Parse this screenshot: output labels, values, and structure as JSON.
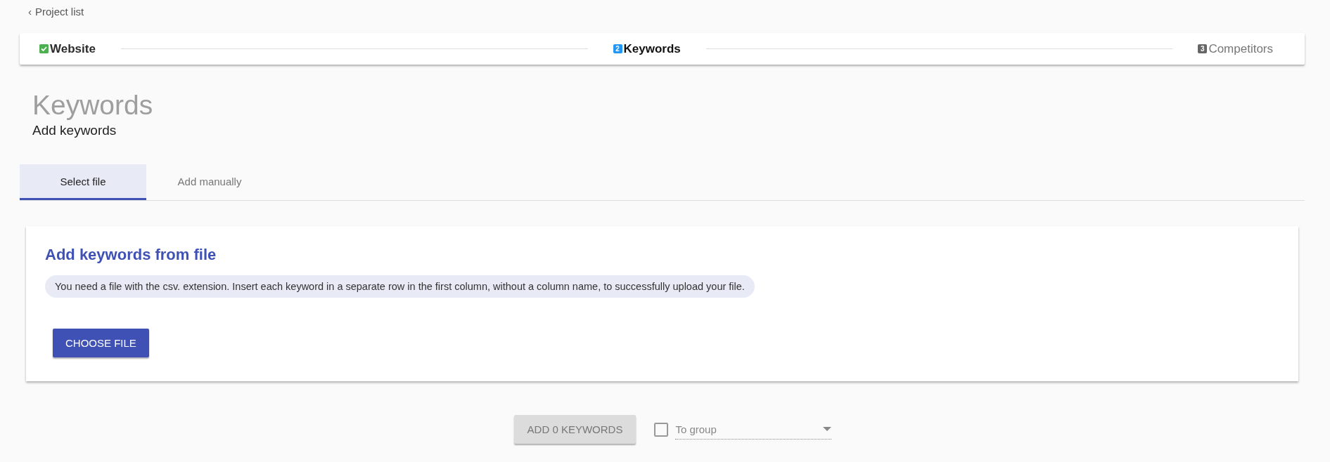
{
  "back_link": {
    "icon": "‹",
    "label": "Project list"
  },
  "stepper": [
    {
      "label": "Website",
      "done": true,
      "selected": false
    },
    {
      "number": "2",
      "label": "Keywords",
      "done": false,
      "selected": true
    },
    {
      "number": "3",
      "label": "Competitors",
      "done": false,
      "selected": false
    }
  ],
  "page": {
    "title": "Keywords",
    "subtitle": "Add keywords"
  },
  "tabs": [
    {
      "label": "Select file",
      "selected": true
    },
    {
      "label": "Add manually",
      "selected": false
    }
  ],
  "card": {
    "title": "Add keywords from file",
    "info": "You need a file with the csv. extension. Insert each keyword in a separate row in the first column, without a column name, to successfully upload your file.",
    "button": "CHOOSE FILE"
  },
  "footer": {
    "add_button": {
      "label": "ADD 0 KEYWORDS",
      "disabled": true
    },
    "to_group": {
      "checked": false,
      "placeholder": "To group"
    }
  }
}
